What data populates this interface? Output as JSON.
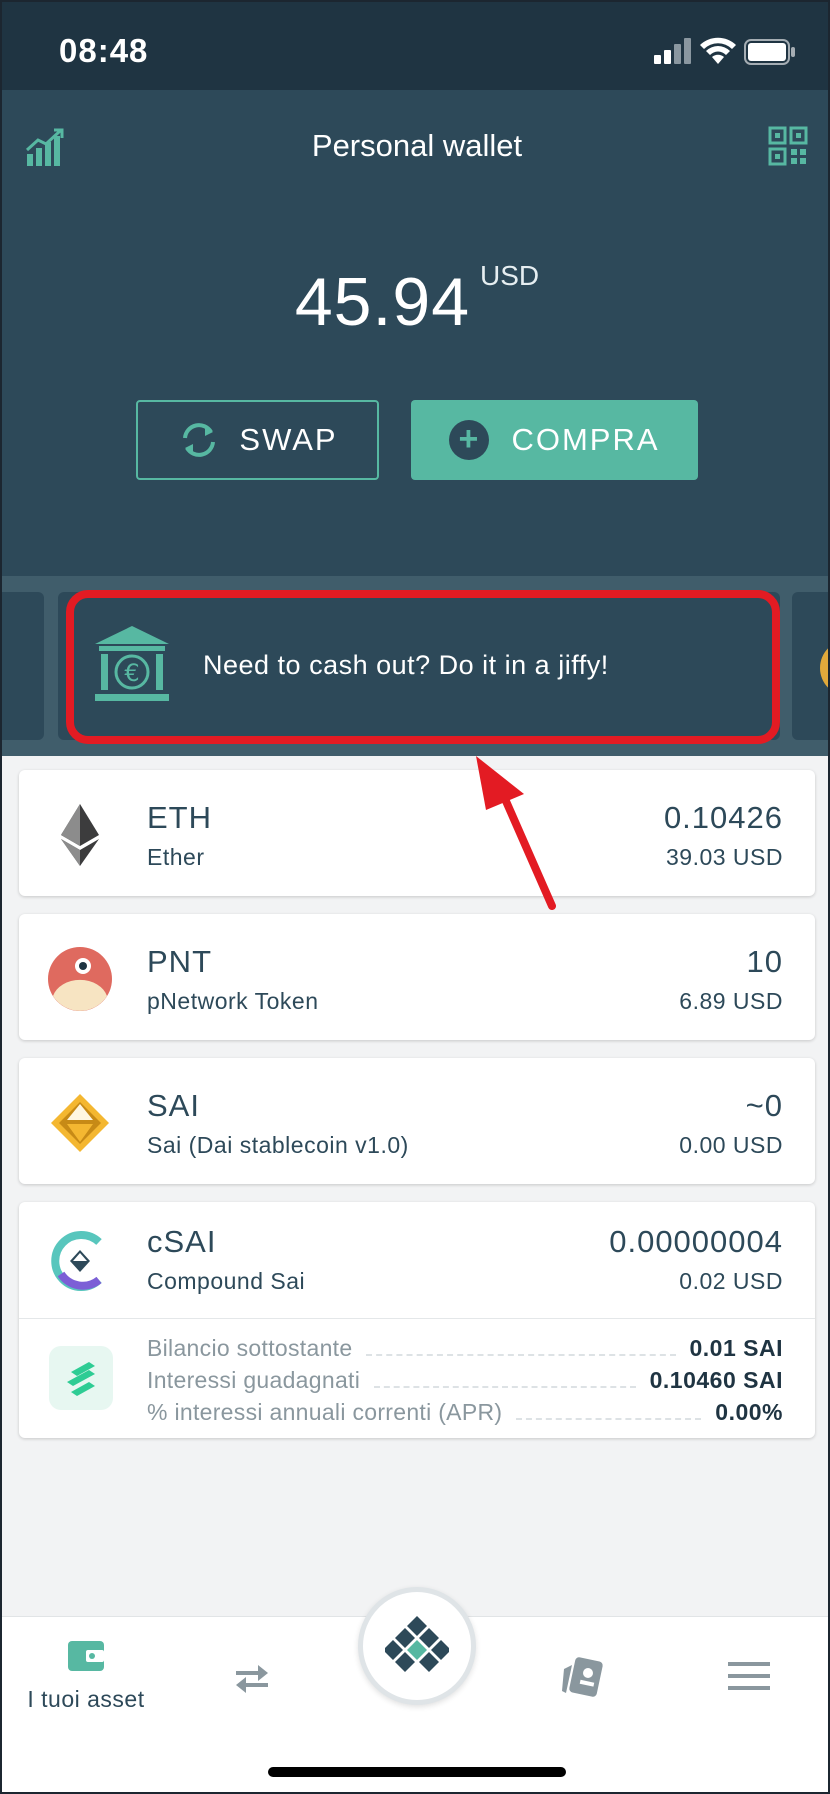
{
  "status_bar": {
    "time": "08:48"
  },
  "header": {
    "title": "Personal wallet",
    "balance_amount": "45.94",
    "balance_unit": "USD",
    "swap_label": "SWAP",
    "buy_label": "COMPRA"
  },
  "promo": {
    "text": "Need to cash out? Do it in a jiffy!"
  },
  "assets": [
    {
      "symbol": "ETH",
      "name": "Ether",
      "quantity": "0.10426",
      "fiat": "39.03 USD"
    },
    {
      "symbol": "PNT",
      "name": "pNetwork Token",
      "quantity": "10",
      "fiat": "6.89 USD"
    },
    {
      "symbol": "SAI",
      "name": "Sai (Dai stablecoin v1.0)",
      "quantity": "~0",
      "fiat": "0.00 USD"
    },
    {
      "symbol": "cSAI",
      "name": "Compound Sai",
      "quantity": "0.00000004",
      "fiat": "0.02 USD"
    }
  ],
  "compound_details": [
    {
      "label": "Bilancio sottostante",
      "value": "0.01 SAI"
    },
    {
      "label": "Interessi guadagnati",
      "value": "0.10460 SAI"
    },
    {
      "label": "% interessi annuali correnti (APR)",
      "value": "0.00%"
    }
  ],
  "bottom_nav": {
    "assets_label": "I tuoi asset"
  },
  "colors": {
    "header_bg": "#2d4959",
    "accent": "#57b8a2",
    "highlight": "#e31b23",
    "text_dark": "#2d4959"
  },
  "icons": [
    "chart-icon",
    "qr-code-icon",
    "swap-icon",
    "plus-icon",
    "bank-euro-icon",
    "eth-logo",
    "pnt-logo",
    "sai-logo",
    "csai-logo",
    "compound-icon",
    "wallet-icon",
    "exchange-icon",
    "diamond-logo",
    "cards-icon",
    "menu-icon"
  ]
}
